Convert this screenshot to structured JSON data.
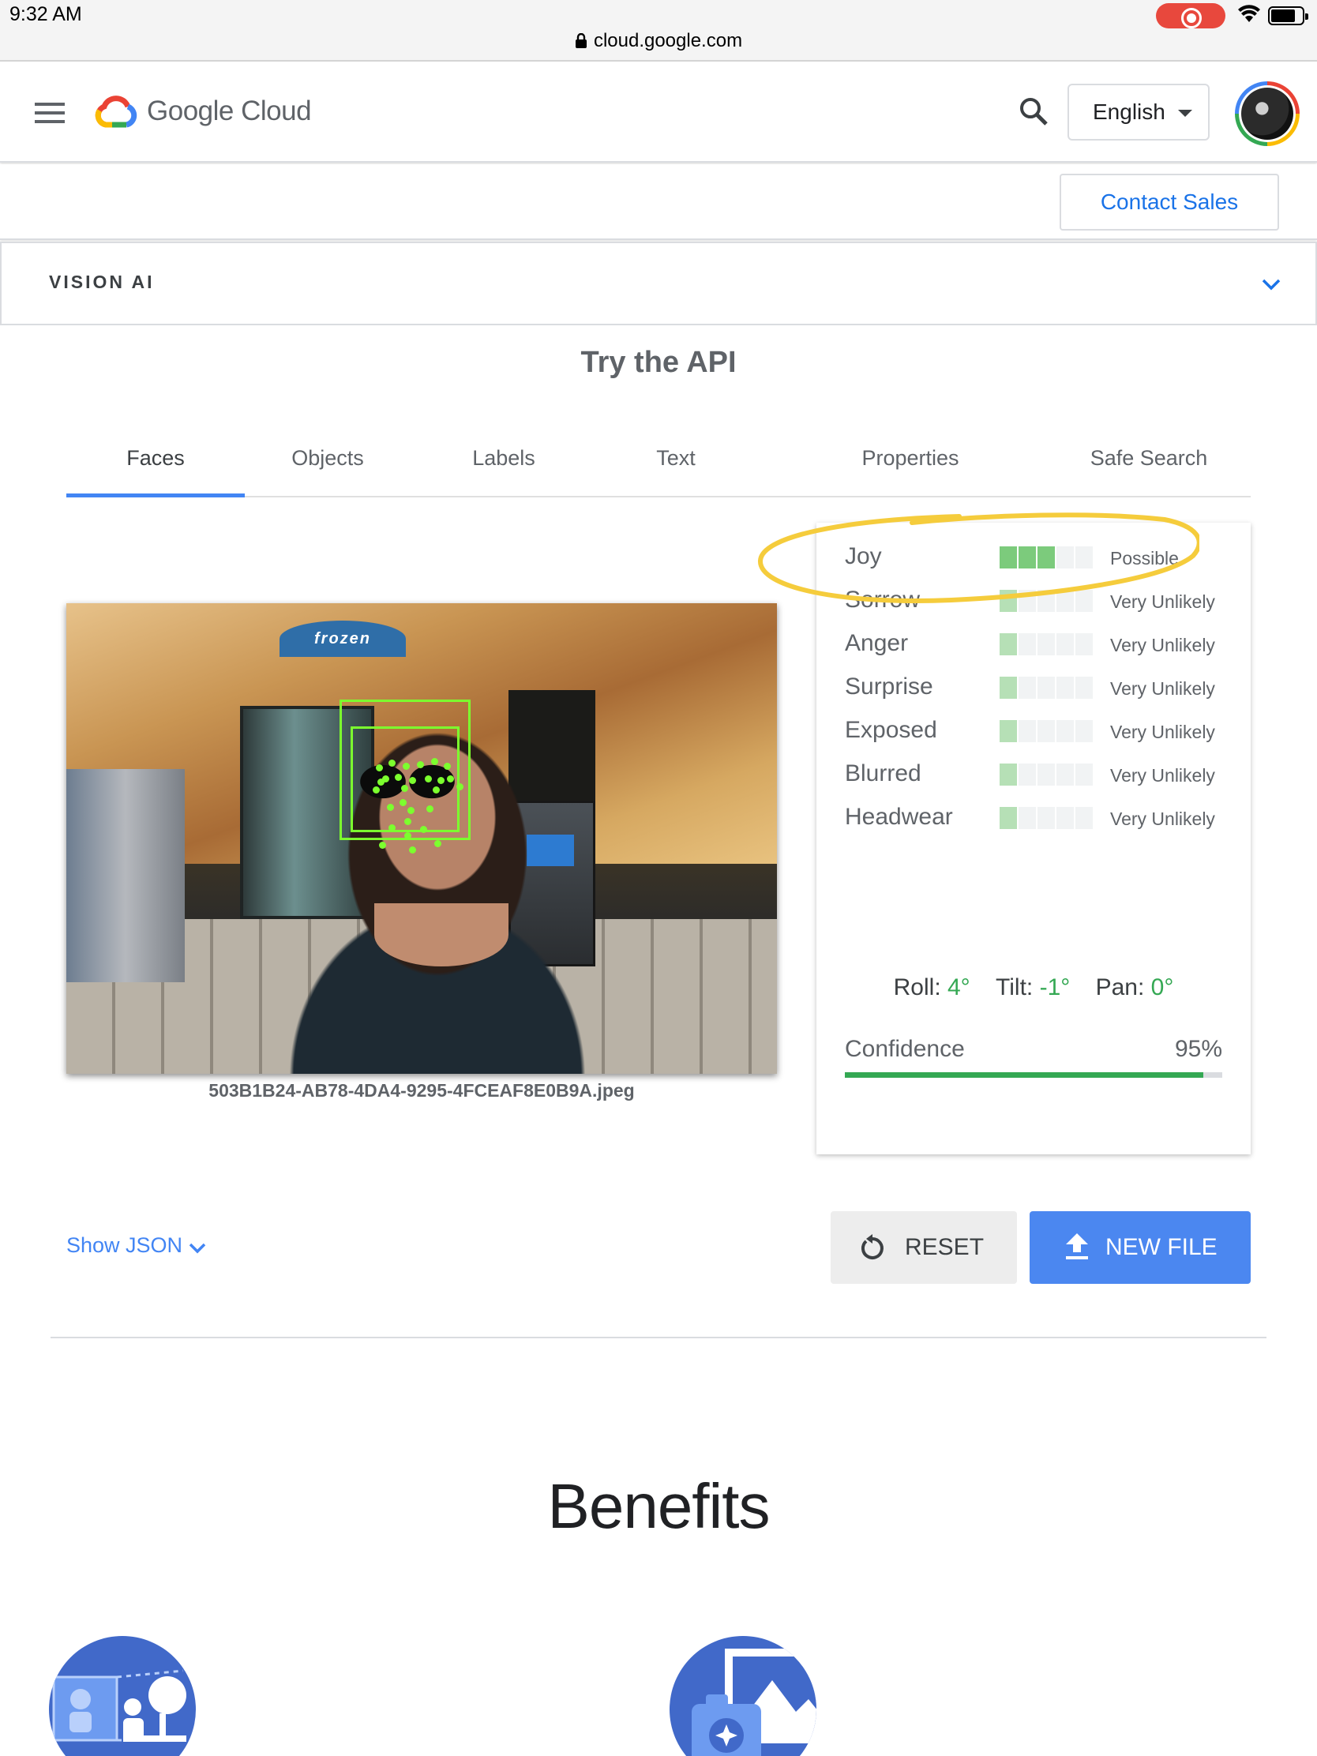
{
  "status_bar": {
    "time": "9:32 AM",
    "url": "cloud.google.com"
  },
  "header": {
    "brand": "Google Cloud",
    "language": "English",
    "contact_label": "Contact Sales"
  },
  "section": {
    "label": "VISION AI"
  },
  "demo": {
    "title": "Try the API",
    "tabs": [
      "Faces",
      "Objects",
      "Labels",
      "Text",
      "Properties",
      "Safe Search"
    ],
    "active_tab": "Faces",
    "image_filename": "503B1B24-AB78-4DA4-9295-4FCEAF8E0B9A.jpeg",
    "image_sign_text": "frozen",
    "results": [
      {
        "label": "Joy",
        "likelihood": "Possible",
        "level": 3
      },
      {
        "label": "Sorrow",
        "likelihood": "Very Unlikely",
        "level": 1
      },
      {
        "label": "Anger",
        "likelihood": "Very Unlikely",
        "level": 1
      },
      {
        "label": "Surprise",
        "likelihood": "Very Unlikely",
        "level": 1
      },
      {
        "label": "Exposed",
        "likelihood": "Very Unlikely",
        "level": 1
      },
      {
        "label": "Blurred",
        "likelihood": "Very Unlikely",
        "level": 1
      },
      {
        "label": "Headwear",
        "likelihood": "Very Unlikely",
        "level": 1
      }
    ],
    "likelihood_scale_max": 5,
    "angles": {
      "roll_label": "Roll:",
      "roll_value": "4°",
      "tilt_label": "Tilt:",
      "tilt_value": "-1°",
      "pan_label": "Pan:",
      "pan_value": "0°"
    },
    "confidence": {
      "label": "Confidence",
      "value_text": "95%",
      "value": 0.95
    },
    "show_json_label": "Show JSON",
    "reset_label": "RESET",
    "new_file_label": "NEW FILE"
  },
  "benefits": {
    "title": "Benefits"
  },
  "colors": {
    "accent": "#4285f4",
    "likely_green": "#7ccb7c",
    "confidence_green": "#34a853",
    "highlight_yellow": "#f5cc3c"
  }
}
